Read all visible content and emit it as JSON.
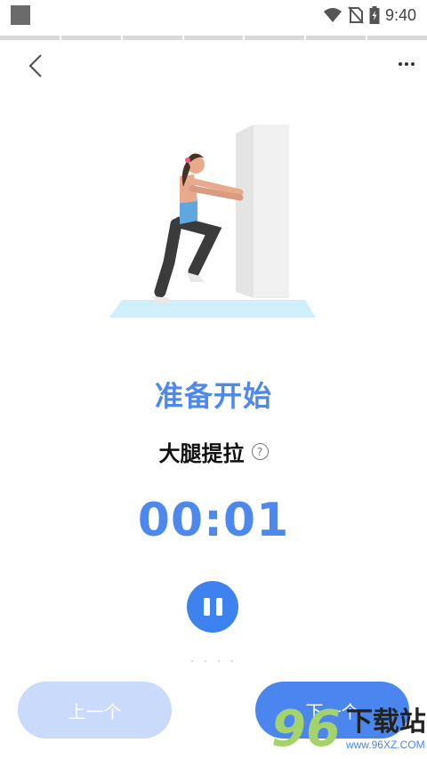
{
  "status_bar": {
    "time": "9:40",
    "icons": [
      "wifi-icon",
      "no-sim-icon",
      "battery-charging-icon"
    ]
  },
  "progress": {
    "segments": 7
  },
  "header": {
    "back_icon": "chevron-left-icon",
    "more_icon": "more-horizontal-icon"
  },
  "workout": {
    "status_title": "准备开始",
    "exercise_name": "大腿提拉",
    "timer": "00:01",
    "faint_caption": "· · · ·"
  },
  "controls": {
    "pause_icon": "pause-icon",
    "prev_label": "上一个",
    "next_label": "下一个"
  },
  "watermark": {
    "logo_digits": "96",
    "site_name": "下载站",
    "url": "www.96XZ.COM"
  },
  "colors": {
    "accent": "#4c88ee",
    "button_primary": "#4a86ee",
    "button_disabled": "#c9dafb"
  }
}
